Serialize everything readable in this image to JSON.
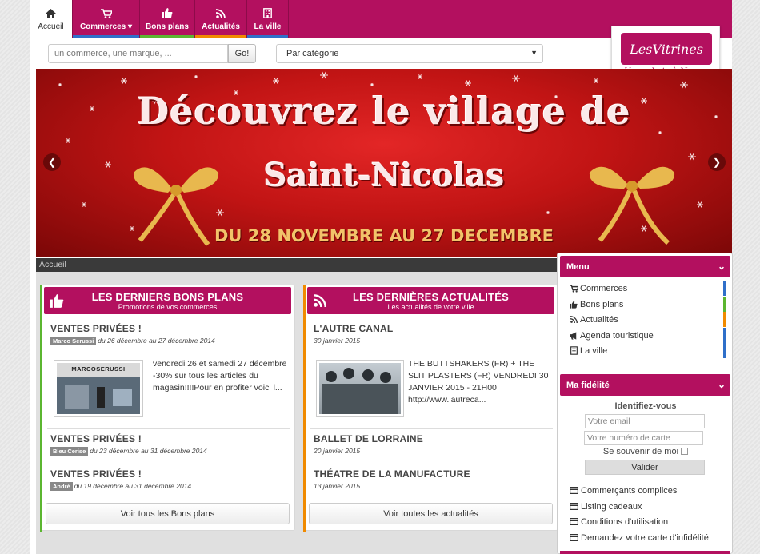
{
  "colors": {
    "brand": "#b3105f",
    "accent_commerces": "#2f6fc9",
    "accent_bons_plans": "#5bb630",
    "accent_actualites": "#f08a00",
    "accent_ville": "#2f6fc9"
  },
  "nav": {
    "items": [
      {
        "label": "Accueil",
        "icon": "home-icon",
        "active": true
      },
      {
        "label": "Commerces",
        "icon": "cart-icon",
        "dropdown": true
      },
      {
        "label": "Bons plans",
        "icon": "thumbs-up-icon"
      },
      {
        "label": "Actualités",
        "icon": "rss-icon"
      },
      {
        "label": "La ville",
        "icon": "building-icon"
      }
    ]
  },
  "search": {
    "placeholder": "un commerce, une marque, ...",
    "go_label": "Go!",
    "category_label": "Par catégorie"
  },
  "logo": {
    "name": "LesVitrines",
    "tagline": "Vos achats à Nancy."
  },
  "banner": {
    "line1": "Découvrez le village de",
    "line2": "Saint-Nicolas",
    "line3": "DU 28 NOVEMBRE AU 27 DECEMBRE"
  },
  "breadcrumb": {
    "current": "Accueil"
  },
  "bons_plans": {
    "title": "LES DERNIERS BONS PLANS",
    "subtitle": "Promotions de vos commerces",
    "entries": [
      {
        "title": "VENTES PRIVÉES !",
        "author": "Marco Serussi",
        "dates": "du 26 décembre au 27 décembre 2014",
        "excerpt": "vendredi 26 et samedi 27 décembre -30% sur tous les articles du magasin!!!!Pour en profiter voici l...",
        "thumb_text": "MARCOSERUSSI"
      },
      {
        "title": "VENTES PRIVÉES !",
        "author": "Bleu Cerise",
        "dates": "du 23 décembre au 31 décembre 2014"
      },
      {
        "title": "VENTES PRIVÉES !",
        "author": "André",
        "dates": "du 19 décembre au 31 décembre 2014"
      }
    ],
    "see_all": "Voir tous les Bons plans"
  },
  "actualites": {
    "title": "LES DERNIÈRES ACTUALITÉS",
    "subtitle": "Les actualités de votre ville",
    "entries": [
      {
        "title": "L'AUTRE CANAL",
        "date": "30 janvier 2015",
        "excerpt": "THE BUTTSHAKERS (FR) + THE SLIT PLASTERS (FR) VENDREDI 30 JANVIER 2015 - 21H00 http://www.lautreca..."
      },
      {
        "title": "BALLET DE LORRAINE",
        "date": "20 janvier 2015"
      },
      {
        "title": "THÉATRE DE LA MANUFACTURE",
        "date": "13 janvier 2015"
      }
    ],
    "see_all": "Voir toutes les actualités"
  },
  "sidebar": {
    "menu_title": "Menu",
    "menu_items": [
      {
        "label": "Commerces",
        "icon": "cart-icon"
      },
      {
        "label": "Bons plans",
        "icon": "thumbs-up-icon"
      },
      {
        "label": "Actualités",
        "icon": "rss-icon"
      },
      {
        "label": "Agenda touristique",
        "icon": "megaphone-icon"
      },
      {
        "label": "La ville",
        "icon": "building-icon"
      }
    ],
    "fidelite_title": "Ma fidélité",
    "identify_label": "Identifiez-vous",
    "email_placeholder": "Votre email",
    "card_placeholder": "Votre numéro de carte",
    "remember_label": "Se souvenir de moi",
    "submit_label": "Valider",
    "fid_items": [
      {
        "label": "Commerçants complices",
        "icon": "card-icon"
      },
      {
        "label": "Listing cadeaux",
        "icon": "card-icon"
      },
      {
        "label": "Conditions d'utilisation",
        "icon": "card-icon"
      },
      {
        "label": "Demandez votre carte d'infidélité",
        "icon": "card-icon"
      }
    ]
  }
}
